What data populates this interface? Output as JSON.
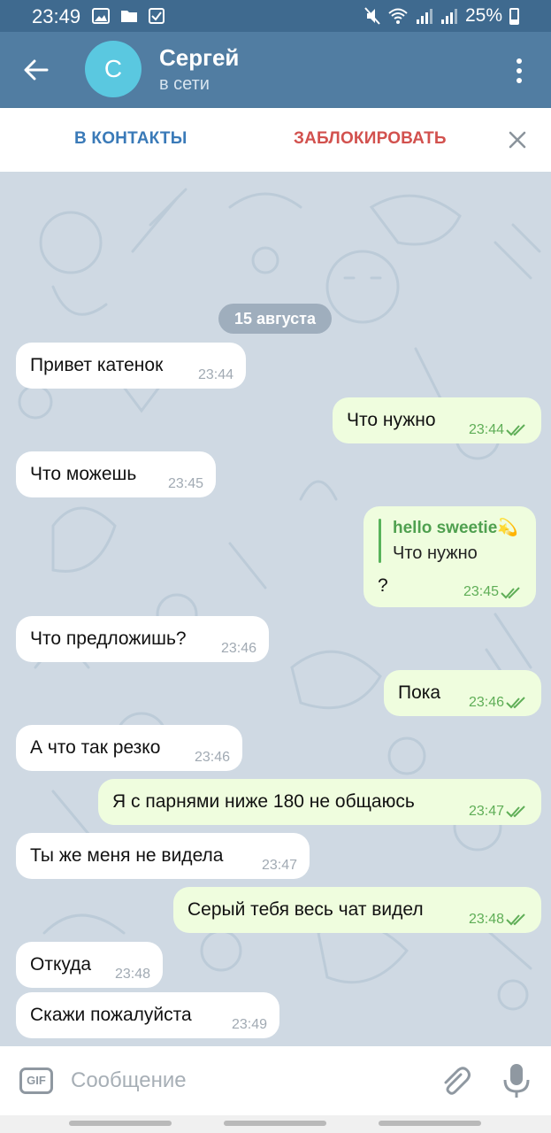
{
  "status_bar": {
    "time": "23:49",
    "battery": "25%",
    "left_icons": [
      "image-icon",
      "folder-icon",
      "check-box-icon"
    ],
    "right_icons": [
      "mute-icon",
      "wifi-icon",
      "signal-icon",
      "signal-icon",
      "battery-icon"
    ]
  },
  "header": {
    "avatar_letter": "С",
    "name": "Сергей",
    "status": "в сети",
    "colors": {
      "bar": "#517da2",
      "status_bar": "#3f6a8f",
      "avatar": "#5ac8e0"
    }
  },
  "actions": {
    "add_contact": "В КОНТАКТЫ",
    "block": "ЗАБЛОКИРОВАТЬ"
  },
  "chat": {
    "date": "15 августа",
    "messages": [
      {
        "dir": "in",
        "text": "Привет катенок",
        "time": "23:44"
      },
      {
        "dir": "out",
        "text": "Что нужно",
        "time": "23:44",
        "read": true
      },
      {
        "dir": "in",
        "text": "Что можешь",
        "time": "23:45"
      },
      {
        "dir": "out",
        "reply_to_name": "hello sweetie💫",
        "reply_to_text": "Что нужно",
        "text": "?",
        "time": "23:45",
        "read": true
      },
      {
        "dir": "in",
        "text": "Что предложишь?",
        "time": "23:46"
      },
      {
        "dir": "out",
        "text": "Пока",
        "time": "23:46",
        "read": true
      },
      {
        "dir": "in",
        "text": "А что так резко",
        "time": "23:46"
      },
      {
        "dir": "out",
        "text": "Я с парнями ниже 180 не общаюсь",
        "time": "23:47",
        "read": true
      },
      {
        "dir": "in",
        "text": "Ты же меня не видела",
        "time": "23:47"
      },
      {
        "dir": "out",
        "text": "Серый тебя весь чат видел",
        "time": "23:48",
        "read": true
      },
      {
        "dir": "in",
        "text": "Откуда",
        "time": "23:48"
      },
      {
        "dir": "in",
        "text": "Скажи пожалуйста",
        "time": "23:49"
      }
    ],
    "colors": {
      "incoming": "#ffffff",
      "outgoing": "#effdde",
      "check": "#5fae57",
      "background": "#cfd9e3"
    }
  },
  "composer": {
    "gif_label": "GIF",
    "placeholder": "Сообщение",
    "value": ""
  }
}
